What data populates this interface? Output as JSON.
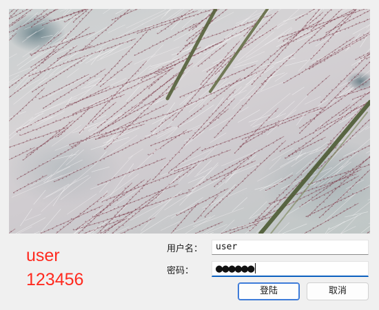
{
  "image": {
    "description_icon": "grass-seedhead-photo"
  },
  "credentials_display": {
    "username_text": "user",
    "password_text": "123456"
  },
  "form": {
    "username_label": "用户名：",
    "username_value": "user",
    "password_label": "密码：",
    "password_masked": "●●●●●●"
  },
  "buttons": {
    "login_label": "登陆",
    "cancel_label": "取消"
  },
  "colors": {
    "window_bg": "#f0f0f0",
    "credential_text": "#ff2a1f",
    "focus_accent": "#0a5fbf",
    "default_button_border": "#2f6fd1"
  }
}
